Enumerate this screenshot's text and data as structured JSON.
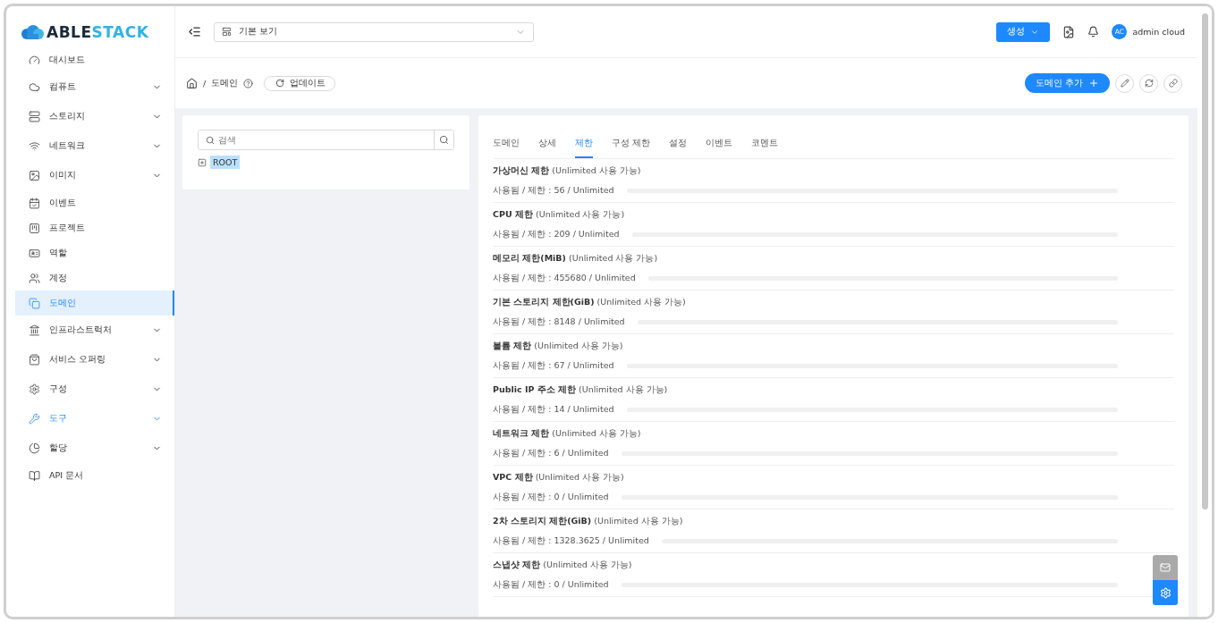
{
  "logo": {
    "part_1": "ABLE",
    "part_2": "STACK"
  },
  "sidebar": {
    "items": [
      {
        "label": "대시보드",
        "has_submenu": false,
        "selected": false,
        "highlighted": false
      },
      {
        "label": "컴퓨트",
        "has_submenu": true,
        "selected": false,
        "highlighted": false
      },
      {
        "label": "스토리지",
        "has_submenu": true,
        "selected": false,
        "highlighted": false
      },
      {
        "label": "네트워크",
        "has_submenu": true,
        "selected": false,
        "highlighted": false
      },
      {
        "label": "이미지",
        "has_submenu": true,
        "selected": false,
        "highlighted": false
      },
      {
        "label": "이벤트",
        "has_submenu": false,
        "selected": false,
        "highlighted": false
      },
      {
        "label": "프로젝트",
        "has_submenu": false,
        "selected": false,
        "highlighted": false
      },
      {
        "label": "역할",
        "has_submenu": false,
        "selected": false,
        "highlighted": false
      },
      {
        "label": "계정",
        "has_submenu": false,
        "selected": false,
        "highlighted": false
      },
      {
        "label": "도메인",
        "has_submenu": false,
        "selected": true,
        "highlighted": false
      },
      {
        "label": "인프라스트럭처",
        "has_submenu": true,
        "selected": false,
        "highlighted": false
      },
      {
        "label": "서비스 오퍼링",
        "has_submenu": true,
        "selected": false,
        "highlighted": false
      },
      {
        "label": "구성",
        "has_submenu": true,
        "selected": false,
        "highlighted": false
      },
      {
        "label": "도구",
        "has_submenu": true,
        "selected": false,
        "highlighted": true
      },
      {
        "label": "할당",
        "has_submenu": true,
        "selected": false,
        "highlighted": false
      },
      {
        "label": "API 문서",
        "has_submenu": false,
        "selected": false,
        "highlighted": false
      }
    ]
  },
  "header": {
    "view_select": "기본 보기",
    "create_button": "생성",
    "user": {
      "initials": "AC",
      "name": "admin cloud"
    }
  },
  "breadcrumb": {
    "separator": "/",
    "current": "도메인",
    "refresh_button": "업데이트",
    "add_button": "도메인 추가"
  },
  "tree": {
    "search_placeholder": "검색",
    "nodes": [
      {
        "label": "ROOT",
        "selected": true
      }
    ]
  },
  "tabs": [
    {
      "label": "도메인",
      "selected": false
    },
    {
      "label": "상세",
      "selected": false
    },
    {
      "label": "제한",
      "selected": true
    },
    {
      "label": "구성 제한",
      "selected": false
    },
    {
      "label": "설정",
      "selected": false
    },
    {
      "label": "이벤트",
      "selected": false
    },
    {
      "label": "코멘트",
      "selected": false
    }
  ],
  "limits": [
    {
      "title": "**가상머신 제한** (Unlimited 사용 가능)",
      "reading": "사용됨 / 제한 : 56 / Unlimited"
    },
    {
      "title": "**CPU 제한** (Unlimited 사용 가능)",
      "reading": "사용됨 / 제한 : 209 / Unlimited"
    },
    {
      "title": "**메모리 제한(MiB)** (Unlimited 사용 가능)",
      "reading": "사용됨 / 제한 : 455680 / Unlimited"
    },
    {
      "title": "**기본 스토리지 제한(GiB)** (Unlimited 사용 가능)",
      "reading": "사용됨 / 제한 : 8148 / Unlimited"
    },
    {
      "title": "**볼륨 제한** (Unlimited 사용 가능)",
      "reading": "사용됨 / 제한 : 67 / Unlimited"
    },
    {
      "title": "**Public IP 주소 제한** (Unlimited 사용 가능)",
      "reading": "사용됨 / 제한 : 14 / Unlimited"
    },
    {
      "title": "**네트워크 제한** (Unlimited 사용 가능)",
      "reading": "사용됨 / 제한 : 6 / Unlimited"
    },
    {
      "title": "**VPC 제한** (Unlimited 사용 가능)",
      "reading": "사용됨 / 제한 : 0 / Unlimited"
    },
    {
      "title": "**2차 스토리지 제한(GiB)** (Unlimited 사용 가능)",
      "reading": "사용됨 / 제한 : 1328.3625 / Unlimited"
    },
    {
      "title": "**스냅샷 제한** (Unlimited 사용 가능)",
      "reading": "사용됨 / 제한 : 0 / Unlimited"
    }
  ]
}
